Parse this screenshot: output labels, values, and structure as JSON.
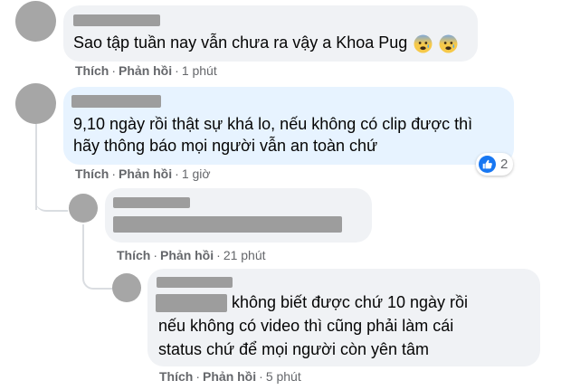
{
  "comments": [
    {
      "text": "Sao tập tuần nay vẫn chưa ra vậy a Khoa Pug",
      "emoji": [
        "anxious-face-icon",
        "anxious-face-icon"
      ],
      "like": "Thích",
      "reply": "Phản hồi",
      "time": "1 phút"
    },
    {
      "lines": [
        "9,10 ngày rồi thật sự khá lo, nếu không có clip được thì",
        "hãy thông báo mọi người vẫn an toàn chứ"
      ],
      "like": "Thích",
      "reply": "Phản hồi",
      "time": "1 giờ",
      "reaction": {
        "icon": "like-icon",
        "count": "2"
      }
    },
    {
      "like": "Thích",
      "reply": "Phản hồi",
      "time": "21 phút"
    },
    {
      "lines": [
        "không biết được chứ 10 ngày rồi",
        "nếu không có video thì cũng phải làm cái",
        "status chứ để mọi người còn yên tâm"
      ],
      "like": "Thích",
      "reply": "Phản hồi",
      "time": "5 phút"
    }
  ],
  "colors": {
    "bubble_grey": "#f0f2f5",
    "bubble_blue": "#e7f3ff",
    "meta_text": "#65676b",
    "like_blue": "#1877f2",
    "redaction": "#9d9d9d"
  }
}
